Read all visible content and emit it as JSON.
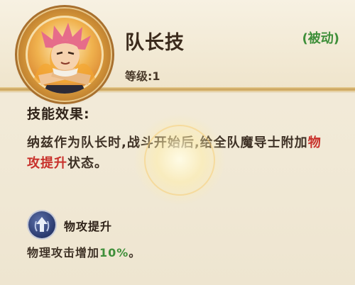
{
  "skill": {
    "title": "队长技",
    "level_text": "等级:1",
    "type_tag": "(被动)"
  },
  "effect": {
    "heading": "技能效果:",
    "desc_part1": "纳兹作为队长时,战斗开始后,给全队魔导士附加",
    "desc_highlight": "物攻提升",
    "desc_part2": "状态。"
  },
  "buff": {
    "name": "物攻提升",
    "desc_prefix": "物理攻击增加",
    "desc_value": "10%",
    "desc_suffix": "。"
  },
  "colors": {
    "highlight_red": "#c8302a",
    "accent_green": "#3f8f3a",
    "gold": "#c9a058"
  },
  "icons": {
    "portrait": "natsu-portrait",
    "buff": "attack-up-icon"
  }
}
